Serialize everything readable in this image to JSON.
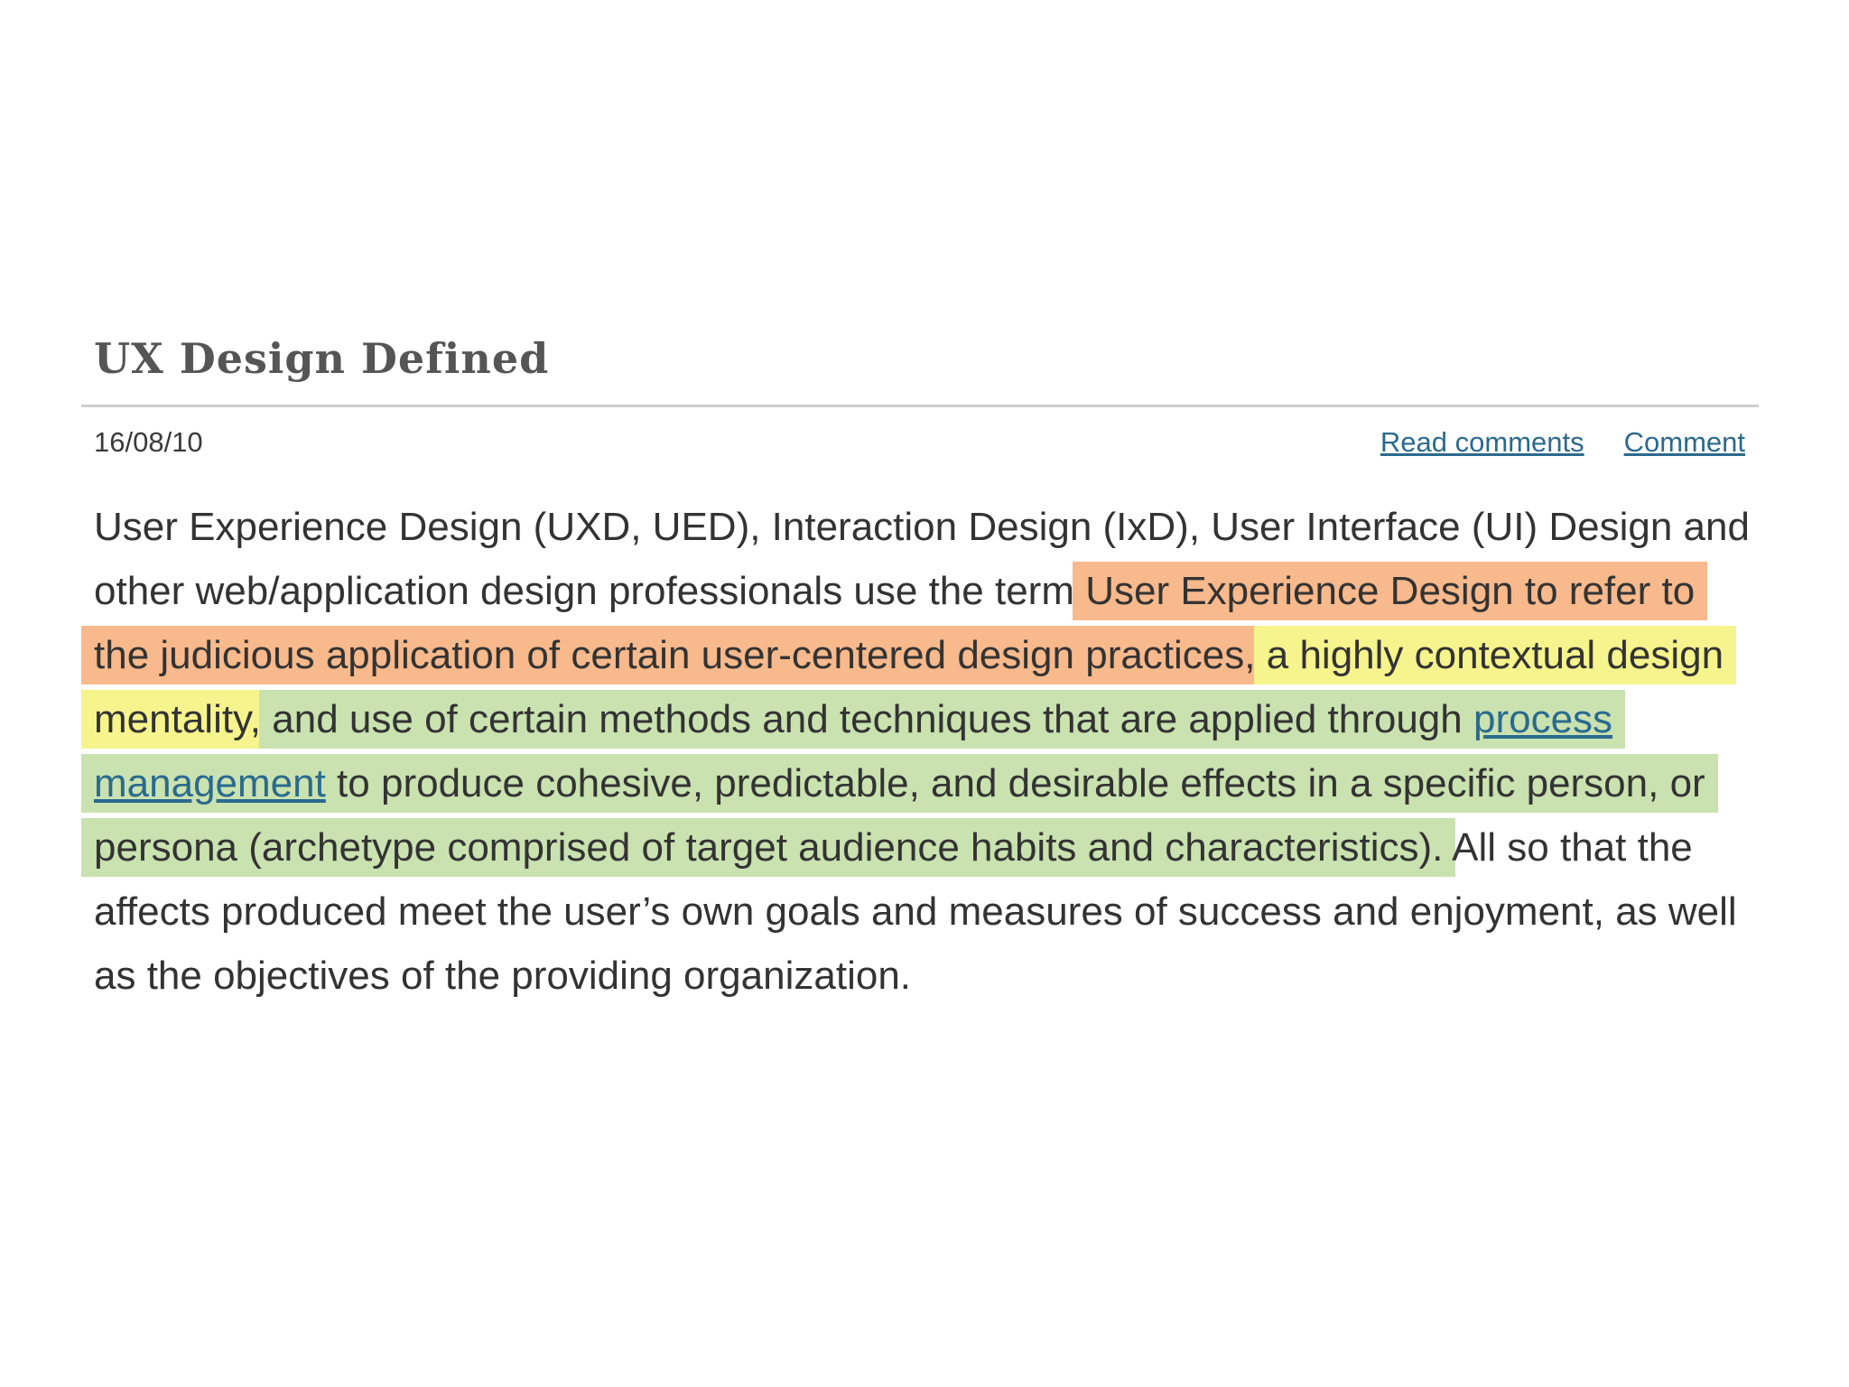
{
  "post": {
    "title": "UX Design Defined",
    "date": "16/08/10",
    "links": {
      "read_comments": "Read comments",
      "comment": "Comment"
    },
    "body": {
      "plain_intro": "User Experience Design (UXD, UED), Interaction Design (IxD), User Interface (UI) Design and other web/application design professionals use the term ",
      "orange_segment": "User Experience Design to refer to the judicious application of certain user-centered design practices,",
      "yellow_segment": "a highly contextual design mentality,",
      "green_before_link": "and use of certain methods and techniques that are applied through ",
      "link_text": "process management",
      "green_after_link": " to produce cohesive, predictable, and desirable effects in a specific person, or persona (archetype comprised of target audience habits and characteristics).",
      "plain_outro": "All so that the affects produced meet the user’s own goals and measures of success and enjoyment, as well as the objectives of the providing organization."
    }
  },
  "colors": {
    "highlight_orange": "#f8b98c",
    "highlight_yellow": "#f6f48d",
    "highlight_green": "#c9e2b0",
    "link": "#2b6a8e",
    "text": "#333333"
  }
}
